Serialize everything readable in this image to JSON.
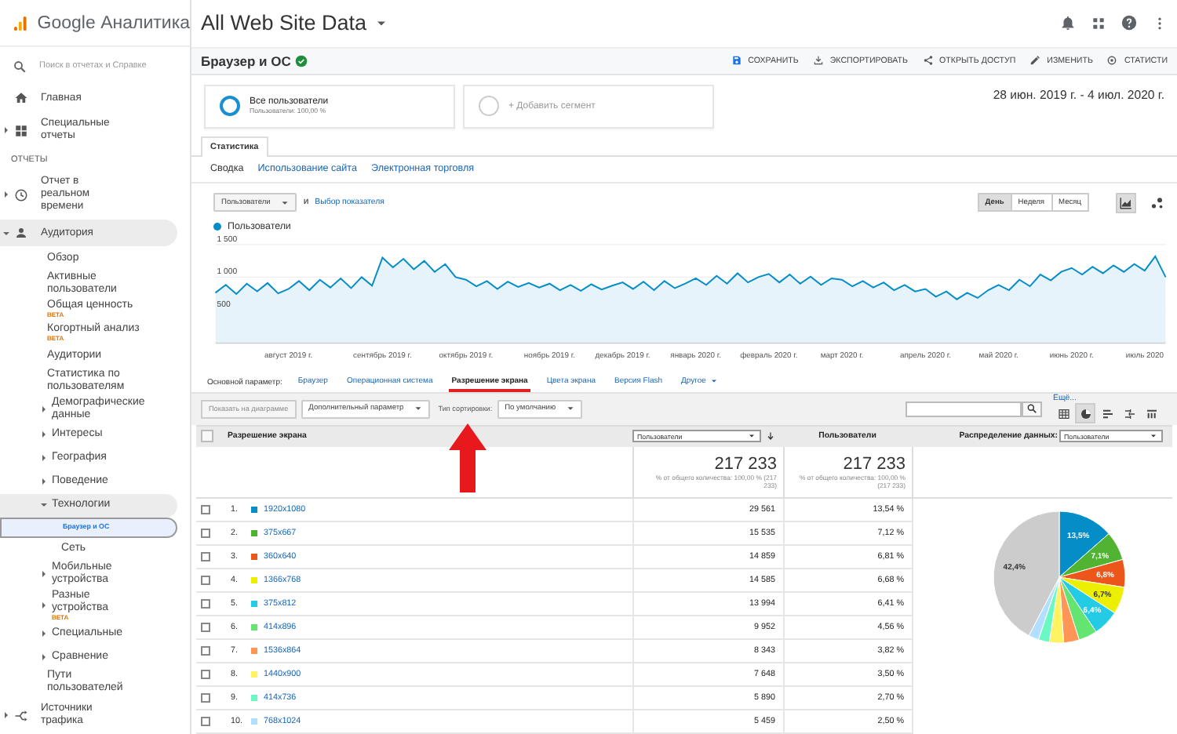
{
  "app": {
    "name": "Google Аналитика"
  },
  "sidebar": {
    "search_placeholder": "Поиск в отчетах и Справке",
    "nav": [
      {
        "kind": "item",
        "label": "Главная"
      },
      {
        "kind": "item",
        "label": "Специальные отчеты",
        "expanded": false
      },
      {
        "kind": "heading",
        "label": "ОТЧЕТЫ"
      },
      {
        "kind": "item",
        "label": "Отчет в реальном времени",
        "expanded": false
      },
      {
        "kind": "item",
        "label": "Аудитория",
        "expanded": true,
        "children": [
          {
            "label": "Обзор",
            "selected": false
          },
          {
            "label": "Активные пользователи",
            "selected": false
          },
          {
            "label": "Общая ценность",
            "badge": "BETA",
            "selected": false
          },
          {
            "label": "Когортный анализ",
            "badge": "BETA",
            "selected": false
          },
          {
            "label": "Аудитории",
            "selected": false
          },
          {
            "label": "Статистика по пользователям",
            "selected": false
          },
          {
            "label": "Демографические данные",
            "expanded": false,
            "selected": false
          },
          {
            "label": "Интересы",
            "expanded": false,
            "selected": false
          },
          {
            "label": "География",
            "expanded": false,
            "selected": false
          },
          {
            "label": "Поведение",
            "expanded": false,
            "selected": false
          },
          {
            "label": "Технологии",
            "expanded": true,
            "selected": false,
            "children": [
              {
                "label": "Браузер и ОС",
                "selected": true
              },
              {
                "label": "Сеть",
                "selected": false
              }
            ]
          },
          {
            "label": "Мобильные устройства",
            "expanded": false,
            "selected": false
          },
          {
            "label": "Разные устройства",
            "badge": "BETA",
            "expanded": false,
            "selected": false
          },
          {
            "label": "Специальные",
            "expanded": false,
            "selected": false
          },
          {
            "label": "Сравнение",
            "expanded": false,
            "selected": false
          },
          {
            "label": "Пути пользователей",
            "selected": false
          }
        ]
      },
      {
        "kind": "item",
        "label": "Источники трафика",
        "expanded": false
      }
    ]
  },
  "header": {
    "property": "All Web Site Data"
  },
  "report": {
    "title": "Браузер и ОС",
    "verified": true,
    "actions": [
      {
        "label": "СОХРАНИТЬ"
      },
      {
        "label": "ЭКСПОРТИРОВАТЬ"
      },
      {
        "label": "ОТКРЫТЬ ДОСТУП"
      },
      {
        "label": "ИЗМЕНИТЬ"
      },
      {
        "label": "СТАТИСТИ"
      }
    ]
  },
  "segments": [
    {
      "kind": "active",
      "name": "Все пользователи",
      "detail": "Пользователи: 100,00 %"
    },
    {
      "kind": "add",
      "name": "+ Добавить сегмент"
    }
  ],
  "date_range": "28 июн. 2019 г. - 4 июл. 2020 г.",
  "tabs": [
    {
      "label": "Статистика",
      "selected": true
    }
  ],
  "subtabs": [
    {
      "label": "Сводка",
      "selected": true
    },
    {
      "label": "Использование сайта",
      "selected": false
    },
    {
      "label": "Электронная торговля",
      "selected": false
    }
  ],
  "chart_controls": {
    "metric": "Пользователи",
    "joiner": "и",
    "add_metric": "Выбор показателя",
    "periods": [
      {
        "label": "День",
        "selected": true
      },
      {
        "label": "Неделя",
        "selected": false
      },
      {
        "label": "Месяц",
        "selected": false
      }
    ],
    "views": [
      {
        "selected": true
      },
      {
        "selected": false
      }
    ]
  },
  "line_chart": {
    "chart_data": {
      "type": "area",
      "categories": [
        null,
        null,
        null,
        null,
        null,
        null,
        null,
        "август 2019 г.",
        null,
        null,
        null,
        null,
        null,
        null,
        null,
        null,
        "сентябрь 2019 г.",
        null,
        null,
        null,
        null,
        null,
        null,
        null,
        "октябрь 2019 г.",
        null,
        null,
        null,
        null,
        null,
        null,
        null,
        "ноябрь 2019 г.",
        null,
        null,
        null,
        null,
        null,
        null,
        "декабрь 2019 г.",
        null,
        null,
        null,
        null,
        null,
        null,
        "январь 2020 г.",
        null,
        null,
        null,
        null,
        null,
        null,
        "февраль 2020 г.",
        null,
        null,
        null,
        null,
        null,
        null,
        "март 2020 г.",
        null,
        null,
        null,
        null,
        null,
        null,
        null,
        "апрель 2020 г.",
        null,
        null,
        null,
        null,
        null,
        null,
        "май 2020 г.",
        null,
        null,
        null,
        null,
        null,
        null,
        "июнь 2020 г.",
        null,
        null,
        null,
        null,
        null,
        null,
        "июль 2020",
        null,
        null
      ],
      "ylim": [
        0,
        1500
      ],
      "series": [
        {
          "name": "Пользователи",
          "color": "#058dc7",
          "values": [
            760,
            880,
            740,
            900,
            780,
            910,
            750,
            820,
            940,
            800,
            960,
            840,
            980,
            830,
            1000,
            870,
            1300,
            1150,
            1280,
            1120,
            1250,
            1080,
            1200,
            1000,
            960,
            860,
            940,
            820,
            930,
            850,
            910,
            840,
            900,
            800,
            880,
            790,
            890,
            810,
            870,
            920,
            820,
            930,
            800,
            940,
            830,
            900,
            980,
            880,
            1020,
            900,
            1060,
            920,
            1000,
            1050,
            920,
            1040,
            900,
            1010,
            880,
            980,
            960,
            860,
            940,
            840,
            920,
            800,
            880,
            780,
            820,
            700,
            780,
            660,
            760,
            680,
            800,
            880,
            800,
            960,
            860,
            1040,
            950,
            1080,
            1140,
            1040,
            1160,
            1060,
            1180,
            1080,
            1200,
            1100,
            1320,
            1000
          ]
        }
      ],
      "yticks": [
        {
          "value": 1500,
          "label": "1 500"
        },
        {
          "value": 1000,
          "label": "1 000"
        },
        {
          "value": 500,
          "label": "500"
        }
      ]
    }
  },
  "dimensions": {
    "label": "Основной параметр:",
    "items": [
      {
        "label": "Браузер",
        "selected": false
      },
      {
        "label": "Операционная система",
        "selected": false
      },
      {
        "label": "Разрешение экрана",
        "selected": true
      },
      {
        "label": "Цвета экрана",
        "selected": false
      },
      {
        "label": "Версия Flash",
        "selected": false
      },
      {
        "label": "Другое",
        "selected": false
      }
    ]
  },
  "toolbar": {
    "plot_button": {
      "label": "Показать на диаграмме",
      "disabled": true
    },
    "secondary": "Дополнительный параметр",
    "sort_label": "Тип сортировки:",
    "sort_value": "По умолчанию",
    "more_link": "Ещё...",
    "views": [
      {
        "selected": false
      },
      {
        "selected": true
      },
      {
        "selected": false
      },
      {
        "selected": false
      },
      {
        "selected": false
      }
    ]
  },
  "table": {
    "select_all": {
      "checked": false
    },
    "dimension_header": "Разрешение экрана",
    "metric_select": "Пользователи",
    "metric_header": "Пользователи",
    "distribution_label": "Распределение данных:",
    "distribution_select": "Пользователи",
    "totals": [
      {
        "value": "217 233",
        "note": "% от общего количества: 100,00 % (217 233)"
      },
      {
        "value": "217 233",
        "note": "% от общего количества: 100,00 % (217 233)"
      }
    ],
    "rows": [
      {
        "rank": "1.",
        "color": "#058dc7",
        "resolution": "1920x1080",
        "users": "29 561",
        "share": "13,54 %",
        "checked": false
      },
      {
        "rank": "2.",
        "color": "#50b432",
        "resolution": "375x667",
        "users": "15 535",
        "share": "7,12 %",
        "checked": false
      },
      {
        "rank": "3.",
        "color": "#ed561b",
        "resolution": "360x640",
        "users": "14 859",
        "share": "6,81 %",
        "checked": false
      },
      {
        "rank": "4.",
        "color": "#edef00",
        "resolution": "1366x768",
        "users": "14 585",
        "share": "6,68 %",
        "checked": false
      },
      {
        "rank": "5.",
        "color": "#24cbe5",
        "resolution": "375x812",
        "users": "13 994",
        "share": "6,41 %",
        "checked": false
      },
      {
        "rank": "6.",
        "color": "#64e572",
        "resolution": "414x896",
        "users": "9 952",
        "share": "4,56 %",
        "checked": false
      },
      {
        "rank": "7.",
        "color": "#ff9655",
        "resolution": "1536x864",
        "users": "8 343",
        "share": "3,82 %",
        "checked": false
      },
      {
        "rank": "8.",
        "color": "#fff263",
        "resolution": "1440x900",
        "users": "7 648",
        "share": "3,50 %",
        "checked": false
      },
      {
        "rank": "9.",
        "color": "#6af9c4",
        "resolution": "414x736",
        "users": "5 890",
        "share": "2,70 %",
        "checked": false
      },
      {
        "rank": "10.",
        "color": "#b2deff",
        "resolution": "768x1024",
        "users": "5 459",
        "share": "2,50 %",
        "checked": false
      }
    ],
    "chart_data": {
      "type": "pie",
      "values": [
        13.54,
        7.12,
        6.81,
        6.68,
        6.41,
        4.56,
        3.82,
        3.5,
        2.7,
        2.5,
        42.36
      ],
      "value_labels": [
        "13,5%",
        "7,1%",
        "6,8%",
        "6,7%",
        "6,4%",
        null,
        null,
        null,
        null,
        null,
        "42,4%"
      ]
    }
  }
}
